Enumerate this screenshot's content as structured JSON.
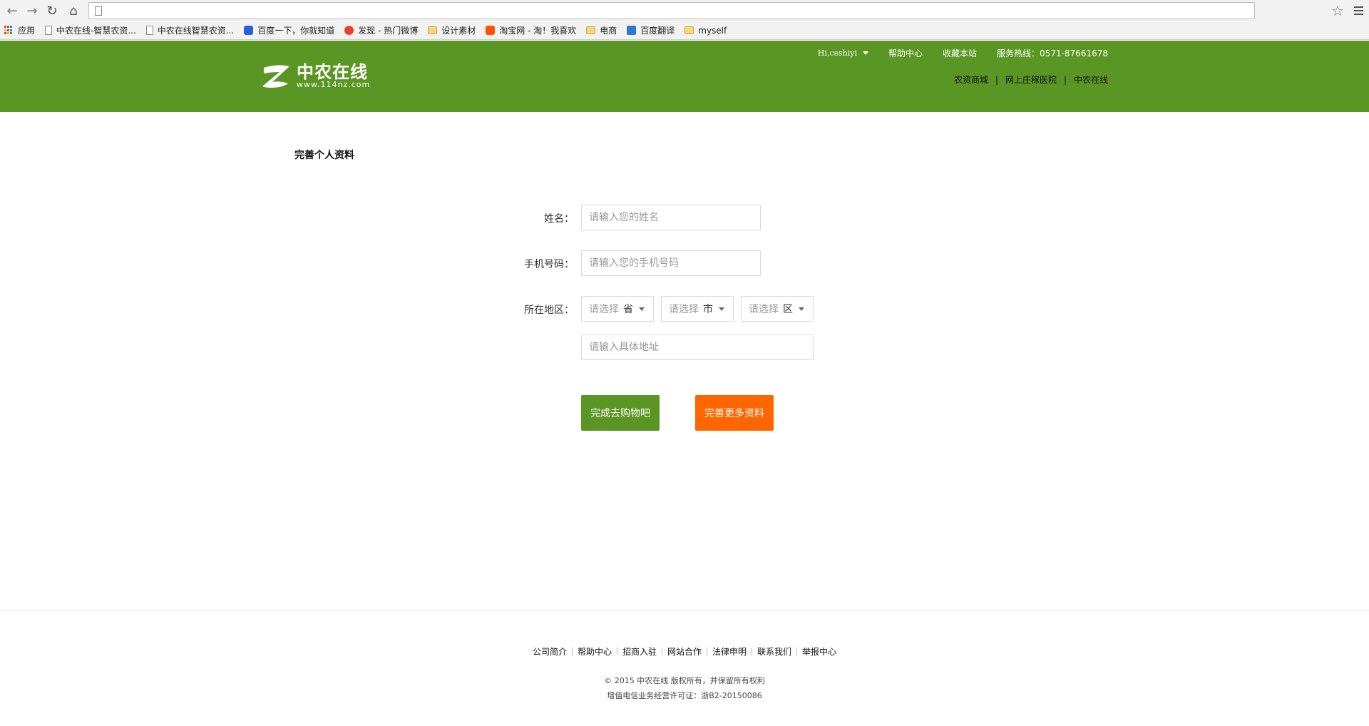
{
  "browser": {
    "bookmarks": [
      {
        "label": "应用",
        "icon": "apps-icon"
      },
      {
        "label": "中农在线-智慧农资...",
        "icon": "page-icon"
      },
      {
        "label": "中农在线智慧农资...",
        "icon": "page-icon"
      },
      {
        "label": "百度一下，你就知道",
        "icon": "baidu-paw-icon"
      },
      {
        "label": "发现 - 热门微博",
        "icon": "weibo-icon"
      },
      {
        "label": "设计素材",
        "icon": "folder-icon"
      },
      {
        "label": "淘宝网 - 淘！我喜欢",
        "icon": "taobao-icon"
      },
      {
        "label": "电商",
        "icon": "folder-icon"
      },
      {
        "label": "百度翻译",
        "icon": "translate-icon"
      },
      {
        "label": "myself",
        "icon": "folder-icon"
      }
    ]
  },
  "header": {
    "logo_cn": "中农在线",
    "logo_url": "www.114nz.com",
    "greeting": "Hi,ceshiyi",
    "help": "帮助中心",
    "bookmark_site": "收藏本站",
    "hotline": "服务热线：0571-87661678",
    "sub_links": [
      "农资商城",
      "网上庄稼医院",
      "中农在线"
    ],
    "sub_sep": "|",
    "brand_color": "#5a9624"
  },
  "main": {
    "title": "完善个人资料",
    "name_label": "姓名：",
    "name_placeholder": "请输入您的姓名",
    "phone_label": "手机号码：",
    "phone_placeholder": "请输入您的手机号码",
    "region_label": "所在地区：",
    "select_placeholder": "请选择",
    "province_unit": "省",
    "city_unit": "市",
    "district_unit": "区",
    "address_placeholder": "请输入具体地址",
    "finish_button": "完成去购物吧",
    "more_button": "完善更多资料",
    "finish_color": "#5a9624",
    "more_color": "#ff6600"
  },
  "footer": {
    "links": [
      "公司简介",
      "帮助中心",
      "招商入驻",
      "网站合作",
      "法律申明",
      "联系我们",
      "举报中心"
    ],
    "copyright": "© 2015 中农在线 版权所有，并保留所有权利",
    "license": "增值电信业务经营许可证：浙B2-20150086"
  }
}
